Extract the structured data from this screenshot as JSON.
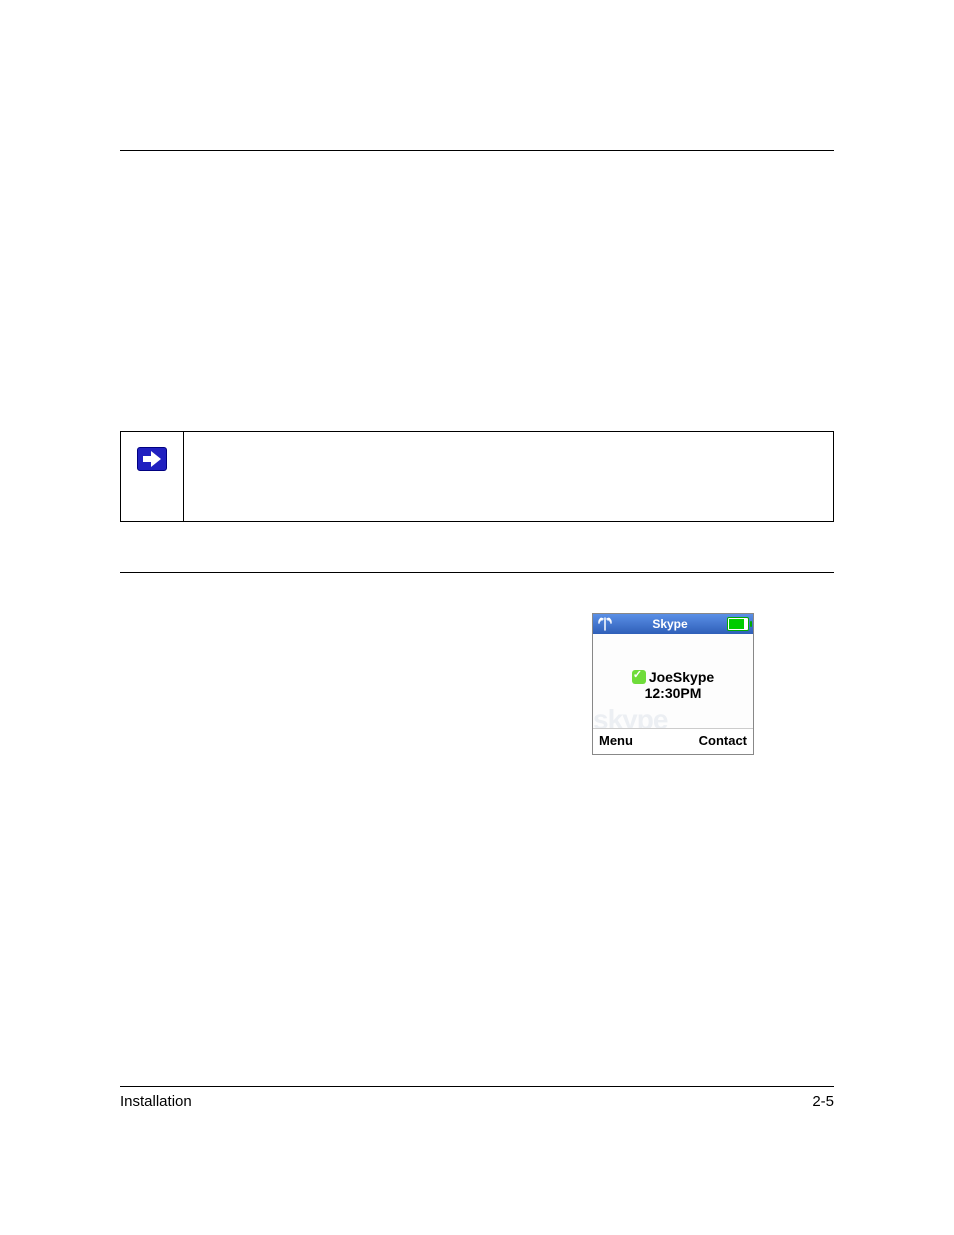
{
  "footer": {
    "section": "Installation",
    "page": "2-5"
  },
  "phone": {
    "statusbar_title": "Skype",
    "username": "JoeSkype",
    "time": "12:30PM",
    "softkey_left": "Menu",
    "softkey_right": "Contact"
  }
}
